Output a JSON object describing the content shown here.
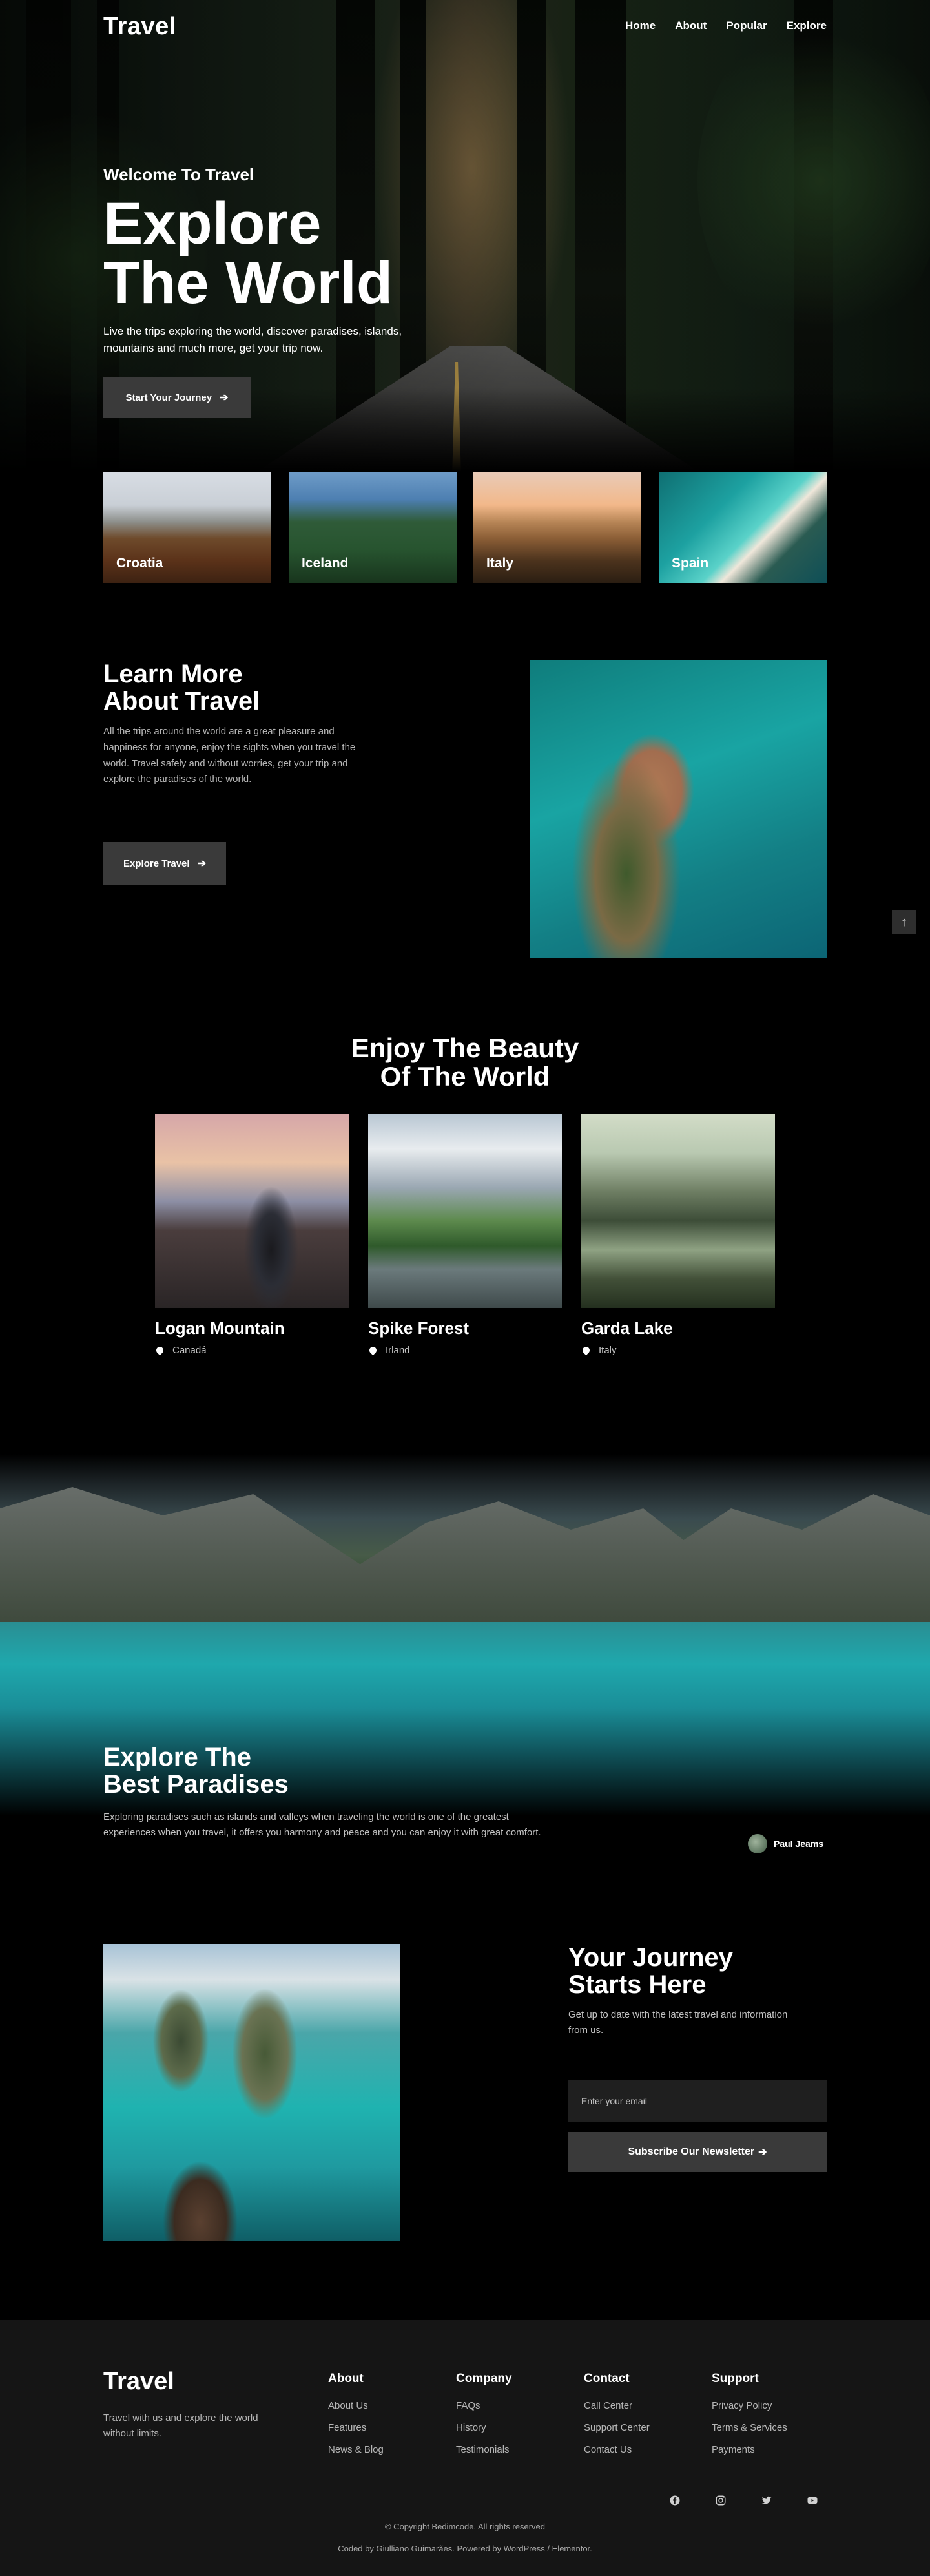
{
  "nav": {
    "logo": "Travel",
    "links": [
      "Home",
      "About",
      "Popular",
      "Explore"
    ]
  },
  "hero": {
    "subtitle": "Welcome To Travel",
    "title_line1": "Explore",
    "title_line2": "The World",
    "description": "Live the trips exploring the world, discover paradises, islands, mountains and much more, get your trip now.",
    "button_label": "Start Your Journey",
    "button_icon": "arrow-right-icon"
  },
  "destinations": [
    "Croatia",
    "Iceland",
    "Italy",
    "Spain"
  ],
  "about": {
    "title_line1": "Learn More",
    "title_line2": "About Travel",
    "description": "All the trips around the world are a great pleasure and happiness for anyone, enjoy the sights when you travel the world. Travel safely and without worries, get your trip and explore the paradises of the world.",
    "button_label": "Explore Travel",
    "button_icon": "arrow-right-icon"
  },
  "scroll_top_icon": "arrow-up-icon",
  "beauty": {
    "title_line1": "Enjoy The Beauty",
    "title_line2": "Of The World",
    "places": [
      {
        "name": "Logan Mountain",
        "location": "Canadá"
      },
      {
        "name": "Spike Forest",
        "location": "Irland"
      },
      {
        "name": "Garda Lake",
        "location": "Italy"
      }
    ]
  },
  "paradises": {
    "title_line1": "Explore The",
    "title_line2": "Best Paradises",
    "description": "Exploring paradises such as islands and valleys when traveling the world is one of the greatest experiences when you travel, it offers you harmony and peace and you can enjoy it with great comfort.",
    "author": "Paul Jeams"
  },
  "newsletter": {
    "title_line1": "Your Journey",
    "title_line2": "Starts Here",
    "description": "Get up to date with the latest travel and information from us.",
    "input_placeholder": "Enter your email",
    "button_label": "Subscribe Our Newsletter",
    "button_icon": "arrow-right-icon"
  },
  "footer": {
    "logo": "Travel",
    "tagline": "Travel with us and explore the world without limits.",
    "columns": [
      {
        "title": "About",
        "links": [
          "About Us",
          "Features",
          "News & Blog"
        ]
      },
      {
        "title": "Company",
        "links": [
          "FAQs",
          "History",
          "Testimonials"
        ]
      },
      {
        "title": "Contact",
        "links": [
          "Call Center",
          "Support Center",
          "Contact Us"
        ]
      },
      {
        "title": "Support",
        "links": [
          "Privacy Policy",
          "Terms & Services",
          "Payments"
        ]
      }
    ],
    "socials": [
      "facebook-icon",
      "instagram-icon",
      "twitter-icon",
      "youtube-icon"
    ],
    "copyright": "© Copyright Bedimcode. All rights reserved",
    "credit": "Coded by Giulliano Guimarães. Powered by WordPress / Elementor."
  }
}
